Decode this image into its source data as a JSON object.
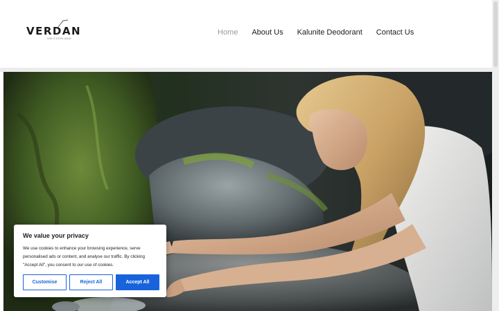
{
  "logo": {
    "word": "VERDAN",
    "tagline": "SWITZERLAND"
  },
  "nav": {
    "items": [
      {
        "label": "Home",
        "active": true
      },
      {
        "label": "About Us",
        "active": false
      },
      {
        "label": "Kalunite Deodorant",
        "active": false
      },
      {
        "label": "Contact Us",
        "active": false
      }
    ]
  },
  "cookie": {
    "title": "We value your privacy",
    "text": "We use cookies to enhance your browsing experience, serve personalised ads or content, and analyse our traffic. By clicking \"Accept All\", you consent to our use of cookies.",
    "customise_label": "Customise",
    "reject_label": "Reject All",
    "accept_label": "Accept All"
  },
  "colors": {
    "accent": "#1863dc",
    "nav_active": "#9a9a9a",
    "text": "#1a1a1a"
  }
}
